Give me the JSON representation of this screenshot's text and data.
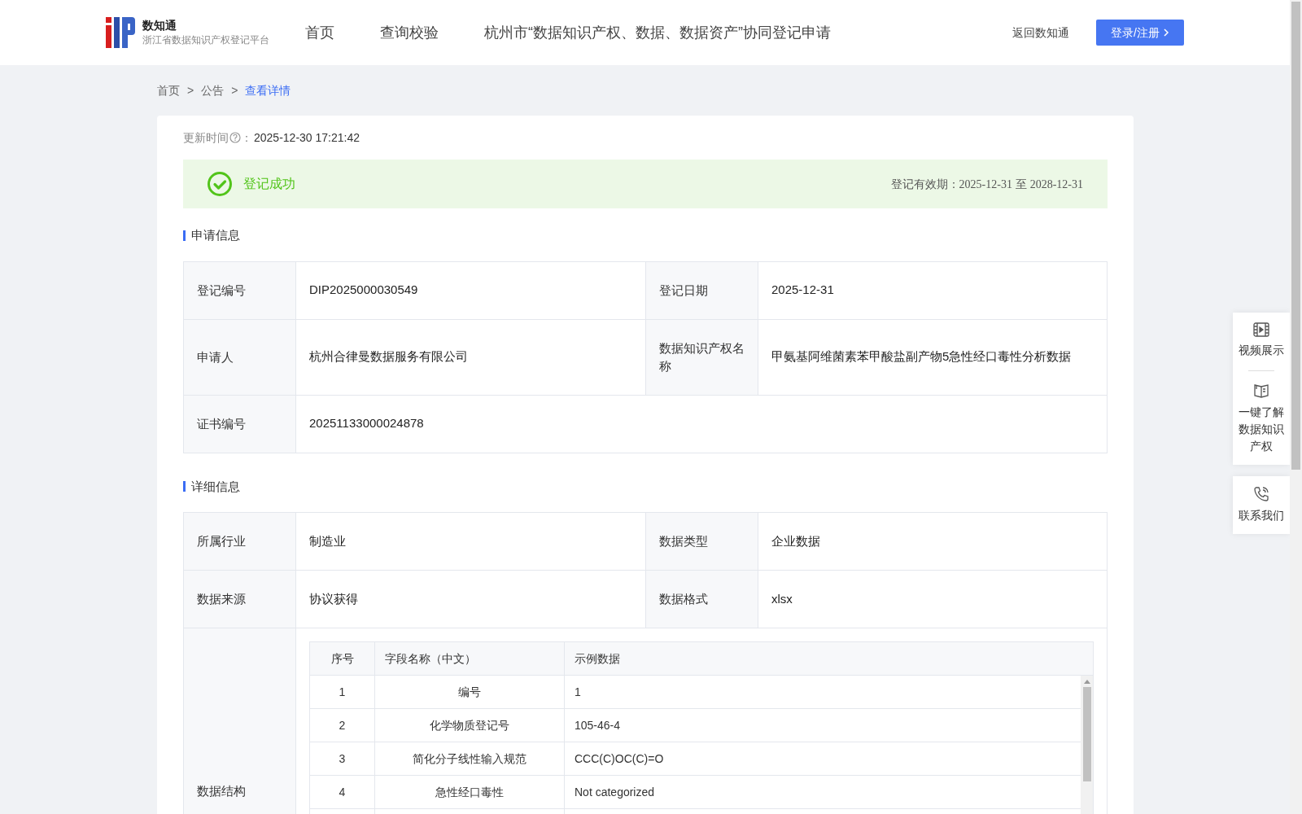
{
  "header": {
    "brand": "数知通",
    "subtitle": "浙江省数据知识产权登记平台",
    "nav": [
      {
        "label": "首页",
        "selected": false
      },
      {
        "label": "查询校验",
        "selected": false
      },
      {
        "label": "杭州市“数据知识产权、数据、数据资产”协同登记申请",
        "selected": false
      }
    ],
    "back_link": "返回数知通",
    "login_button": "登录/注册"
  },
  "breadcrumb": [
    {
      "label": "首页",
      "selected": false
    },
    {
      "label": "公告",
      "selected": false
    },
    {
      "label": "查看详情",
      "selected": true
    }
  ],
  "breadcrumb_separator": ">",
  "update_time": {
    "label": "更新时间",
    "colon": "：",
    "value": "2025-12-30 17:21:42"
  },
  "status_banner": {
    "success": true,
    "text": "登记成功",
    "validity_label": "登记有效期：",
    "validity_start": "2025-12-31",
    "validity_to": "至",
    "validity_end": "2028-12-31"
  },
  "application_section": {
    "title": "申请信息",
    "rows": [
      {
        "cells": [
          {
            "label": "登记编号",
            "value": "DIP2025000030549"
          },
          {
            "label": "登记日期",
            "value": "2025-12-31"
          }
        ]
      },
      {
        "cells": [
          {
            "label": "申请人",
            "value": "杭州合律曼数据服务有限公司"
          },
          {
            "label": "数据知识产权名称",
            "value": "甲氨基阿维菌素苯甲酸盐副产物5急性经口毒性分析数据"
          }
        ]
      },
      {
        "cells": [
          {
            "label": "证书编号",
            "value": "20251133000024878"
          }
        ]
      }
    ]
  },
  "detail_section": {
    "title": "详细信息",
    "rows": [
      {
        "cells": [
          {
            "label": "所属行业",
            "value": "制造业"
          },
          {
            "label": "数据类型",
            "value": "企业数据"
          }
        ]
      },
      {
        "cells": [
          {
            "label": "数据来源",
            "value": "协议获得"
          },
          {
            "label": "数据格式",
            "value": "xlsx"
          }
        ]
      }
    ],
    "structure": {
      "label": "数据结构",
      "columns": [
        "序号",
        "字段名称（中文）",
        "示例数据"
      ],
      "rows": [
        [
          "1",
          "编号",
          "1"
        ],
        [
          "2",
          "化学物质登记号",
          "105-46-4"
        ],
        [
          "3",
          "简化分子线性输入规范",
          "CCC(C)OC(C)=O"
        ],
        [
          "4",
          "急性经口毒性",
          "Not categorized"
        ]
      ]
    }
  },
  "side_panel": [
    {
      "kind": "video",
      "label": "视频展示"
    },
    {
      "kind": "book",
      "label": "一键了解数据知识产权"
    },
    {
      "kind": "phone",
      "label": "联系我们"
    }
  ]
}
